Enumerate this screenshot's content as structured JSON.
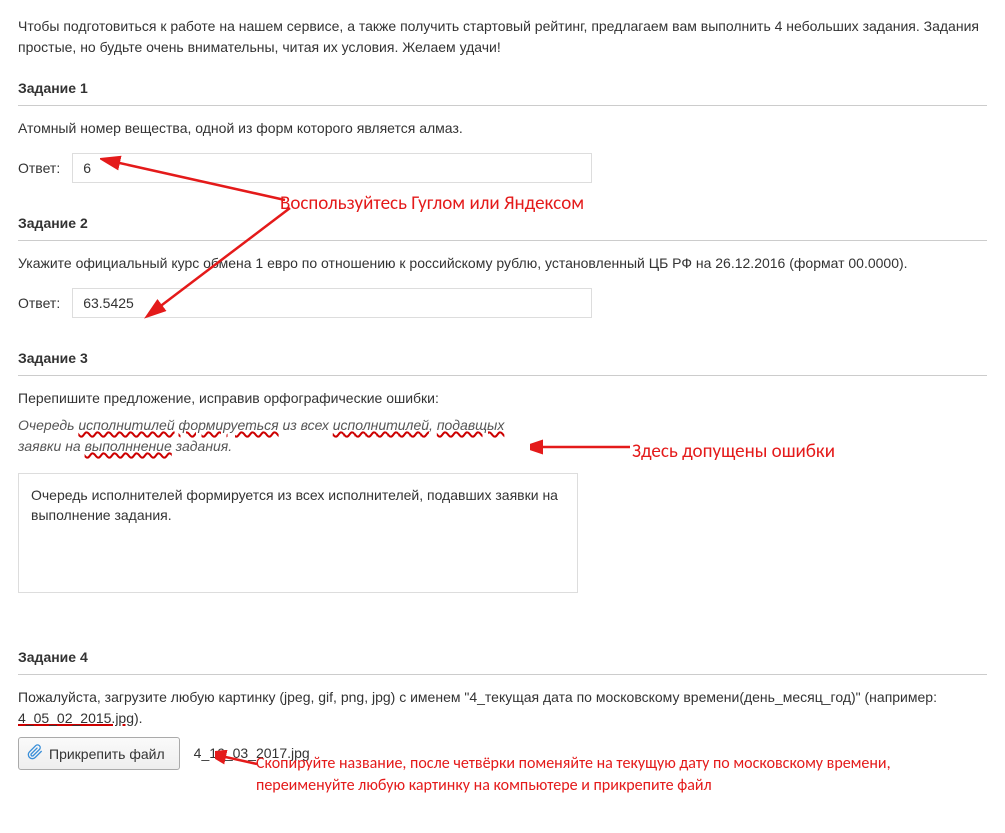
{
  "intro": "Чтобы подготовиться к работе на нашем сервисе, а также получить стартовый рейтинг, предлагаем вам выполнить 4 небольших задания. Задания простые, но будьте очень внимательны, читая их условия. Желаем удачи!",
  "answer_label": "Ответ:",
  "task1": {
    "title": "Задание 1",
    "prompt": "Атомный номер вещества, одной из форм которого является алмаз.",
    "value": "6"
  },
  "task2": {
    "title": "Задание 2",
    "prompt": "Укажите официальный курс обмена 1 евро по отношению к российскому рублю, установленный ЦБ РФ на 26.12.2016 (формат 00.0000).",
    "value": "63.5425"
  },
  "task3": {
    "title": "Задание 3",
    "prompt": "Перепишите предложение, исправив орфографические ошибки:",
    "italic_p1": "Очередь ",
    "italic_w1": "исполнитилей",
    "italic_p2": " ",
    "italic_w2": "формируеться",
    "italic_p3": " из всех ",
    "italic_w3": "исполнитилей",
    "italic_p4": ", ",
    "italic_w4": "подавщых",
    "italic_p5": " заявки на ",
    "italic_w5": "выполннение",
    "italic_p6": " задания.",
    "value": "Очередь исполнителей формируется из всех исполнителей, подавших заявки на выполнение задания."
  },
  "task4": {
    "title": "Задание 4",
    "desc_p1": "Пожалуйста, загрузите любую картинку (jpeg, gif, png, jpg) с именем \"4_текущая дата по московскому времени(день_месяц_год)\" (например: ",
    "example": "4_05_02_2015.jpg",
    "desc_p2": ").",
    "attach_label": "Прикрепить файл",
    "file_name": "4_16_03_2017.jpg"
  },
  "anno": {
    "a1": "Воспользуйтесь Гуглом или Яндексом",
    "a2": "Здесь допущены ошибки",
    "a3": "Скопируйте название, после четвёрки поменяйте на текущую дату по московскому времени, переименуйте любую картинку на компьютере и прикрепите файл"
  }
}
